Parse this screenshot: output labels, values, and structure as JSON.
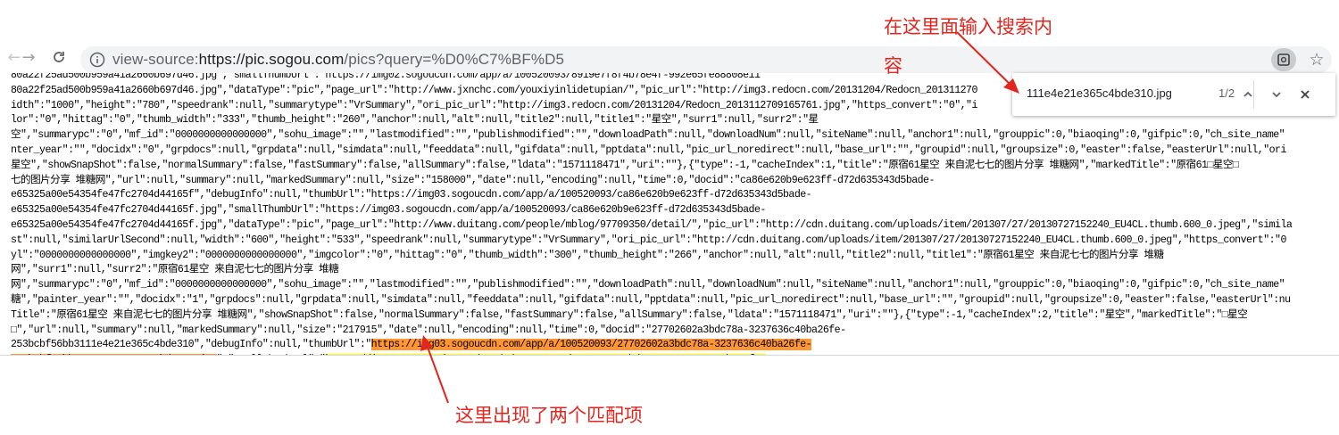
{
  "browser": {
    "url_prefix": "view-source:",
    "url_host": "https://pic.sogou.com",
    "url_path": "/pics?query=%D0%C7%BF%D5"
  },
  "find_bar": {
    "query": "111e4e21e365c4bde310.jpg",
    "match_count": "1/2"
  },
  "source_lines": [
    {
      "text": "80a22f25ad500b959a41a2660b697d46.jpg\",\"smallThumbUrl\":\"https://img02.sogoucdn.com/app/a/100520093/8919e7f8f4b78e4f-992e65fe88808e11"
    },
    {
      "text": "80a22f25ad500b959a41a2660b697d46.jpg\",\"dataType\":\"pic\",\"page_url\":\"http://www.jxnchc.com/youxiyinlidetupian/\",\"pic_url\":\"http://img3.redocn.com/20131204/Redocn_201311270"
    },
    {
      "text": "idth\":\"1000\",\"height\":\"780\",\"speedrank\":null,\"summarytype\":\"VrSummary\",\"ori_pic_url\":\"http://img3.redocn.com/20131204/Redocn_2013112709165761.jpg\",\"https_convert\":\"0\",\"i"
    },
    {
      "text": "lor\":\"0\",\"hittag\":\"0\",\"thumb_width\":\"333\",\"thumb_height\":\"260\",\"anchor\":null,\"alt\":null,\"title2\":null,\"title1\":\"星空\",\"surr1\":null,\"surr2\":\"星"
    },
    {
      "text": "空\",\"summarypc\":\"0\",\"mf_id\":\"0000000000000000\",\"sohu_image\":\"\",\"lastmodified\":\"\",\"publishmodified\":\"\",\"downloadPath\":null,\"downloadNum\":null,\"siteName\":null,\"anchor1\":null,\"grouppic\":0,\"biaoqing\":0,\"gifpic\":0,\"ch_site_name\""
    },
    {
      "text": "nter_year\":\"\",\"docidx\":\"0\",\"grpdocs\":null,\"grpdata\":null,\"simdata\":null,\"feeddata\":null,\"gifdata\":null,\"pptdata\":null,\"pic_url_noredirect\":null,\"base_url\":\"\",\"groupid\":null,\"groupsize\":0,\"easter\":false,\"easterUrl\":null,\"ori"
    },
    {
      "text": "星空\",\"showSnapShot\":false,\"normalSummary\":false,\"fastSummary\":false,\"allSummary\":false,\"ldata\":\"1571118471\",\"uri\":\"\"},{\"type\":-1,\"cacheIndex\":1,\"title\":\"原宿61星空 来自泥七七的图片分享 堆糖网\",\"markedTitle\":\"原宿61□星空□ "
    },
    {
      "text": "七的图片分享 堆糖网\",\"url\":null,\"summary\":null,\"markedSummary\":null,\"size\":\"158000\",\"date\":null,\"encoding\":null,\"time\":0,\"docid\":\"ca86e620b9e623ff-d72d635343d5bade-"
    },
    {
      "text": "e65325a00e54354fe47fc2704d44165f\",\"debugInfo\":null,\"thumbUrl\":\"https://img03.sogoucdn.com/app/a/100520093/ca86e620b9e623ff-d72d635343d5bade-"
    },
    {
      "text": "e65325a00e54354fe47fc2704d44165f.jpg\",\"smallThumbUrl\":\"https://img03.sogoucdn.com/app/a/100520093/ca86e620b9e623ff-d72d635343d5bade-"
    },
    {
      "text": "e65325a00e54354fe47fc2704d44165f.jpg\",\"dataType\":\"pic\",\"page_url\":\"http://www.duitang.com/people/mblog/97709350/detail/\",\"pic_url\":\"http://cdn.duitang.com/uploads/item/201307/27/20130727152240_EU4CL.thumb.600_0.jpeg\",\"simila"
    },
    {
      "text": "st\":null,\"similarUrlSecond\":null,\"width\":\"600\",\"height\":\"533\",\"speedrank\":null,\"summarytype\":\"VrSummary\",\"ori_pic_url\":\"http://cdn.duitang.com/uploads/item/201307/27/20130727152240_EU4CL.thumb.600_0.jpeg\",\"https_convert\":\"0"
    },
    {
      "text": "yl\":\"0000000000000000\",\"imgkey2\":\"0000000000000000\",\"imgcolor\":\"0\",\"hittag\":\"0\",\"thumb_width\":\"300\",\"thumb_height\":\"266\",\"anchor\":null,\"alt\":null,\"title2\":null,\"title1\":\"原宿61星空 来自泥七七的图片分享 堆糖"
    },
    {
      "text": "网\",\"surr1\":null,\"surr2\":\"原宿61星空 来自泥七七的图片分享 堆糖"
    },
    {
      "text": "网\",\"summarypc\":\"0\",\"mf_id\":\"0000000000000000\",\"sohu_image\":\"\",\"lastmodified\":\"\",\"publishmodified\":\"\",\"downloadPath\":null,\"downloadNum\":null,\"siteName\":null,\"anchor1\":null,\"grouppic\":0,\"biaoqing\":0,\"gifpic\":0,\"ch_site_name\""
    },
    {
      "text": "糖\",\"painter_year\":\"\",\"docidx\":\"1\",\"grpdocs\":null,\"grpdata\":null,\"simdata\":null,\"feeddata\":null,\"gifdata\":null,\"pptdata\":null,\"pic_url_noredirect\":null,\"base_url\":\"\",\"groupid\":null,\"groupsize\":0,\"easter\":false,\"easterUrl\":nu"
    },
    {
      "text": "Title\":\"原宿61星空 来自泥七七的图片分享 堆糖网\",\"showSnapShot\":false,\"normalSummary\":false,\"fastSummary\":false,\"allSummary\":false,\"ldata\":\"1571118471\",\"uri\":\"\"},{\"type\":-1,\"cacheIndex\":2,\"title\":\"星空\",\"markedTitle\":\"□星空"
    },
    {
      "text": "□\",\"url\":null,\"summary\":null,\"markedSummary\":null,\"size\":\"217915\",\"date\":null,\"encoding\":null,\"time\":0,\"docid\":\"27702602a3bdc78a-3237636c40ba26fe-"
    },
    {
      "text": "253bcbf56bb3111e4e21e365c4bde310\",\"debugInfo\":null,\"thumbUrl\":\"",
      "hl": "https://img03.sogoucdn.com/app/a/100520093/27702602a3bdc78a-3237636c40ba26fe-",
      "hl_class": "hl-orange"
    },
    {
      "text": "",
      "hl": "253bcbf56bb3111e4e21e365c4bde310.jpg",
      "hl_class": "hl-orange",
      "after": "\",\"smallThumbUrl\":\"",
      "hl2": "https://img03.sogoucdn.com/app/a/100520093/27702602a3bdc78a-3237636c40ba26fe-",
      "hl2_class": "hl-yellow"
    },
    {
      "text": "",
      "hl": "253bcbf56bb3111e4e21e365c4bde310.jpg",
      "hl_class": "hl-yellow",
      "after": "\",\"dataType\":\"pic\",\"page_url\":\"http://www.deskcar.com/html/2602/8.shtml\",\"pic_url\":\"http://www.deskcar.com/desktop/fengjing/20071215104602/8.jpg\",\"similarUrlFirst\":null,\"similarUrlSecond\""
    },
    {
      "text": "idth\":\"2560\",\"height\":\"1600\",\"speedrank\":null,\"summarytype\":\"VrSummary\",\"ori_pic_url\":\"http://www.deskcar.com/desktop/fengjing/20071215104602/8.jpg\",\"https_convert\":\"0\",\"imgkey\":\"0000000000000000\""
    }
  ],
  "annotations": {
    "top_note_line1": "在这里面输入搜索内",
    "top_note_line2": "容",
    "bottom_note": "这里出现了两个匹配项"
  },
  "colors": {
    "annotation_red": "#e0261e",
    "highlight_active": "#ff9632",
    "highlight_match": "#ffff00"
  },
  "icons": {
    "back": "arrow-left-icon",
    "forward": "arrow-right-icon",
    "reload": "reload-icon",
    "info": "info-icon",
    "extension": "extension-icon",
    "bookmark": "star-icon",
    "find_prev": "chevron-up-icon",
    "find_next": "chevron-down-icon",
    "find_close": "close-icon"
  }
}
